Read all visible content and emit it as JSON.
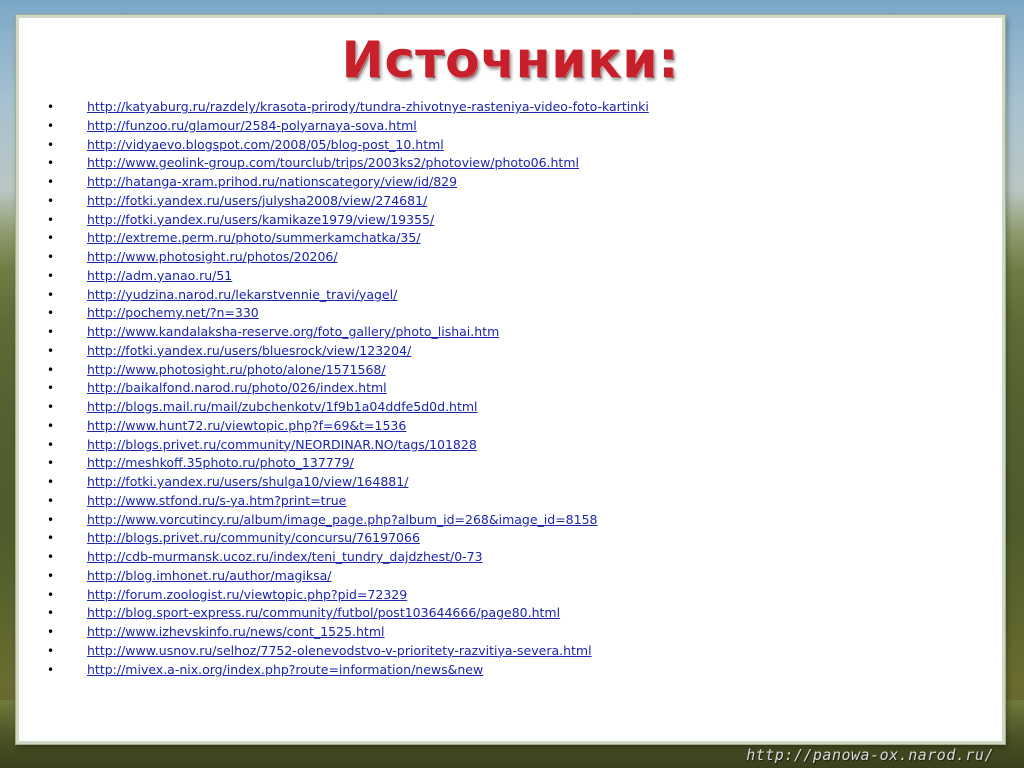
{
  "title": "Источники:",
  "links": [
    "http://katyaburg.ru/razdely/krasota-prirody/tundra-zhivotnye-rasteniya-video-foto-kartinki",
    "http://funzoo.ru/glamour/2584-polyarnaya-sova.html",
    "http://vidyaevo.blogspot.com/2008/05/blog-post_10.html",
    "http://www.geolink-group.com/tourclub/trips/2003ks2/photoview/photo06.html",
    "http://hatanga-xram.prihod.ru/nationscategory/view/id/829",
    "http://fotki.yandex.ru/users/julysha2008/view/274681/",
    "http://fotki.yandex.ru/users/kamikaze1979/view/19355/",
    "http://extreme.perm.ru/photo/summerkamchatka/35/",
    "http://www.photosight.ru/photos/20206/",
    "http://adm.yanao.ru/51",
    "http://yudzina.narod.ru/lekarstvennie_travi/yagel/",
    "http://pochemy.net/?n=330",
    "http://www.kandalaksha-reserve.org/foto_gallery/photo_lishai.htm",
    "http://fotki.yandex.ru/users/bluesrock/view/123204/",
    "http://www.photosight.ru/photo/alone/1571568/",
    "http://baikalfond.narod.ru/photo/026/index.html",
    "http://blogs.mail.ru/mail/zubchenkotv/1f9b1a04ddfe5d0d.html",
    "http://www.hunt72.ru/viewtopic.php?f=69&t=1536",
    "http://blogs.privet.ru/community/NEORDINAR.NO/tags/101828",
    "http://meshkoff.35photo.ru/photo_137779/",
    "http://fotki.yandex.ru/users/shulga10/view/164881/",
    "http://www.stfond.ru/s-ya.htm?print=true",
    "http://www.vorcutincy.ru/album/image_page.php?album_id=268&image_id=8158",
    "http://blogs.privet.ru/community/concursu/76197066",
    "http://cdb-murmansk.ucoz.ru/index/teni_tundry_dajdzhest/0-73",
    "http://blog.imhonet.ru/author/magiksa/",
    "http://forum.zoologist.ru/viewtopic.php?pid=72329",
    "http://blog.sport-express.ru/community/futbol/post103644666/page80.html",
    "http://www.izhevskinfo.ru/news/cont_1525.html",
    "http://www.usnov.ru/selhoz/7752-olenevodstvo-v-prioritety-razvitiya-severa.html",
    "http://mivex.a-nix.org/index.php?route=information/news&new"
  ],
  "bullet": "•",
  "watermark": "http://panowa-ox.narod.ru/",
  "colors": {
    "title": "#c8202a",
    "link": "#1b27a8",
    "card": "#ffffff"
  }
}
